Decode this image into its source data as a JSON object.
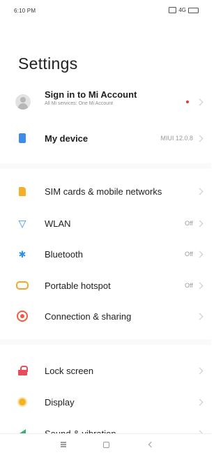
{
  "status_bar": {
    "time": "6:10 PM",
    "right_text": "4G"
  },
  "title": "Settings",
  "account": {
    "label": "Sign in to Mi Account",
    "subtitle": "All Mi services: One Mi Account",
    "icon": "avatar-icon",
    "has_notification_dot": true
  },
  "my_device": {
    "label": "My device",
    "value": "MIUI 12.0.8",
    "icon": "device-icon"
  },
  "network_items": [
    {
      "label": "SIM cards & mobile networks",
      "value": "",
      "icon": "sim-card-icon"
    },
    {
      "label": "WLAN",
      "value": "Off",
      "icon": "wifi-icon"
    },
    {
      "label": "Bluetooth",
      "value": "Off",
      "icon": "bluetooth-icon"
    },
    {
      "label": "Portable hotspot",
      "value": "Off",
      "icon": "hotspot-icon"
    },
    {
      "label": "Connection & sharing",
      "value": "",
      "icon": "connection-icon"
    }
  ],
  "personal_items": [
    {
      "label": "Lock screen",
      "icon": "lock-icon"
    },
    {
      "label": "Display",
      "icon": "display-icon"
    },
    {
      "label": "Sound & vibration",
      "icon": "sound-icon"
    }
  ],
  "nav": {
    "menu": "menu-icon",
    "home": "home-icon",
    "back": "back-icon"
  },
  "colors": {
    "device": "#3d8bea",
    "sim": "#f5b02a",
    "wlan": "#2a8ff0",
    "bluetooth": "#2a8ff0",
    "hotspot": "#f2a62a",
    "connection": "#ef5d45",
    "lock": "#e84b5a",
    "display": "#f5b02a",
    "sound": "#35b36a",
    "notification_dot": "#e53935"
  }
}
